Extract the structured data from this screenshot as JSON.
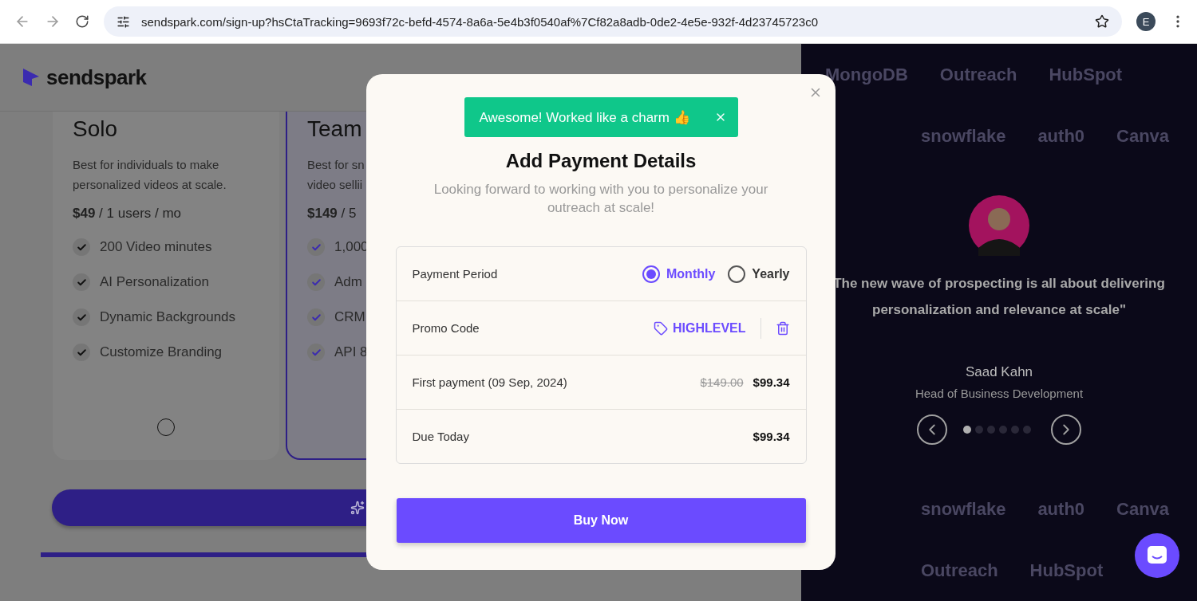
{
  "browser": {
    "url": "sendspark.com/sign-up?hsCtaTracking=9693f72c-befd-4574-8a6a-5e4b3f0540af%7Cf82a8adb-0de2-4e5e-932f-4d23745723c0",
    "profile": "E"
  },
  "page": {
    "logo": "sendspark",
    "plans": [
      {
        "name": "Solo",
        "description": "Best for individuals to make personalized videos at scale.",
        "price": "$49",
        "price_rest": " / 1 users / mo",
        "features": [
          "200 Video minutes",
          "AI Personalization",
          "Dynamic Backgrounds",
          "Customize Branding"
        ],
        "highlighted": false,
        "selected": false
      },
      {
        "name": "Team",
        "description": "Best for sn\nvideo sellii",
        "price": "$149",
        "price_rest": " / 5",
        "features": [
          "1,000",
          "Adm",
          "CRM",
          "API 8"
        ],
        "highlighted": true
      }
    ]
  },
  "modal": {
    "toast": "Awesome! Worked like a charm 👍",
    "title": "Add Payment Details",
    "subtitle": "Looking forward to working with you to personalize your outreach at scale!",
    "rows": [
      {
        "kind": "period",
        "label": "Payment Period",
        "options": [
          {
            "label": "Monthly",
            "selected": true
          },
          {
            "label": "Yearly",
            "selected": false
          }
        ]
      },
      {
        "kind": "promo",
        "label": "Promo Code",
        "code": "HIGHLEVEL"
      },
      {
        "kind": "price",
        "label": "First payment (09 Sep, 2024)",
        "old": "$149.00",
        "value": "$99.34"
      },
      {
        "kind": "price",
        "label": "Due Today",
        "value": "$99.34"
      }
    ],
    "button": "Buy Now"
  },
  "testimonial": {
    "logo_rows": [
      [
        "MongoDB",
        "Outreach",
        "HubSpot"
      ],
      [
        "snowflake",
        "auth0",
        "Canva"
      ],
      [
        "snowflake",
        "auth0",
        "Canva"
      ],
      [
        "Outreach",
        "HubSpot"
      ]
    ],
    "quote": "The new wave of prospecting is all about delivering personalization and relevance at scale\"",
    "name": "Saad Kahn",
    "role": "Head of Business Development",
    "dots": [
      {
        "selected": true
      },
      {
        "selected": false
      },
      {
        "selected": false
      },
      {
        "selected": false
      },
      {
        "selected": false
      },
      {
        "selected": false
      }
    ]
  }
}
